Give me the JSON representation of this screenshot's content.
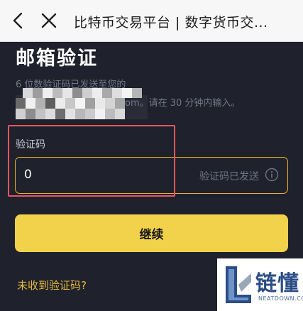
{
  "topbar": {
    "title": "比特币交易平台 | 数字货币交...",
    "back_icon": "chevron-left-icon",
    "close_icon": "close-icon"
  },
  "verify": {
    "heading": "邮箱验证",
    "hint_line1": "6 位数验证码已发送至您的",
    "hint_line2_tail": "om。请在 30 分钟内输入。"
  },
  "code_field": {
    "label": "验证码",
    "value": "0",
    "status": "验证码已发送",
    "info_icon": "info-circle-icon"
  },
  "continue_button": {
    "label": "继续"
  },
  "resend_link": {
    "label": "未收到验证码?"
  },
  "watermark": {
    "name": "链懂",
    "url": "NEATDOWN.COM"
  },
  "colors": {
    "background": "#1f222c",
    "accent": "#f2d24a",
    "input_border": "#e7b32a",
    "annotation": "#e8565c",
    "link": "#e6b83a"
  }
}
